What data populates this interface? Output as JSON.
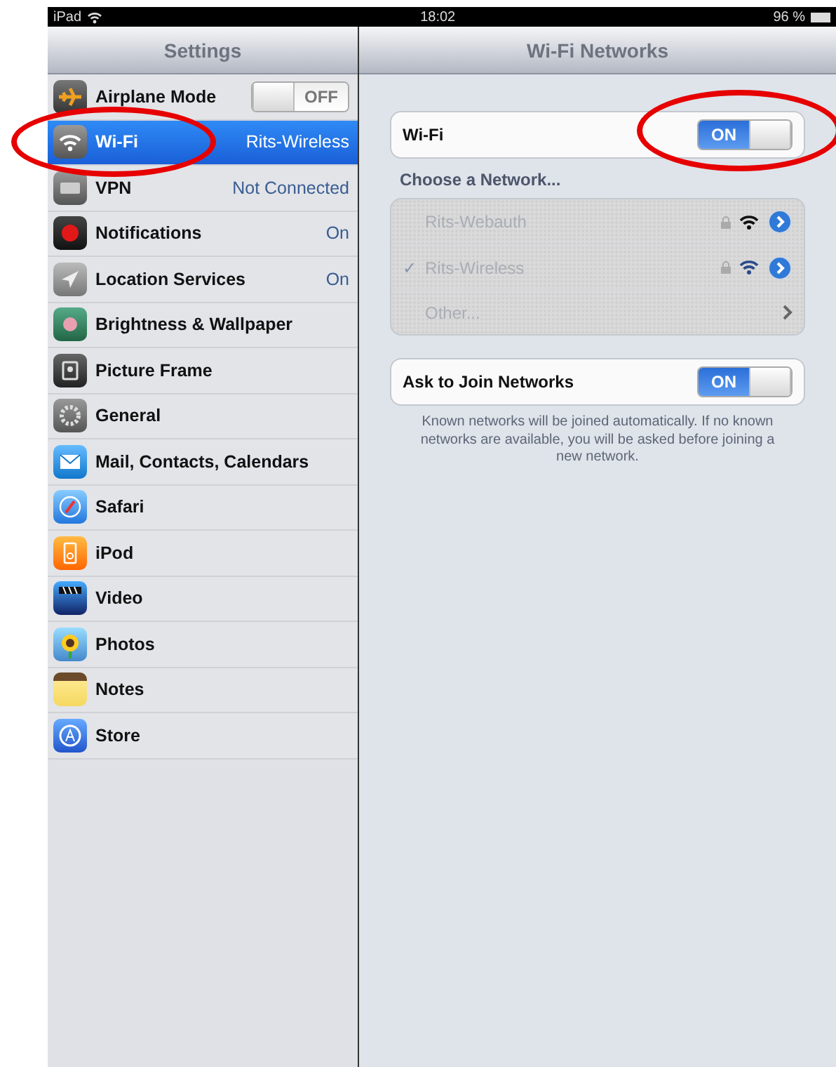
{
  "status_bar": {
    "device": "iPad",
    "time": "18:02",
    "battery": "96 %"
  },
  "sidebar": {
    "title": "Settings",
    "items": [
      {
        "label": "Airplane Mode",
        "kind": "toggle",
        "on": false,
        "toggle_label": "OFF",
        "selected": false
      },
      {
        "label": "Wi-Fi",
        "kind": "value",
        "value": "Rits-Wireless",
        "selected": true
      },
      {
        "label": "VPN",
        "kind": "value",
        "value": "Not Connected",
        "selected": false
      },
      {
        "label": "Notifications",
        "kind": "value",
        "value": "On",
        "selected": false
      },
      {
        "label": "Location Services",
        "kind": "value",
        "value": "On",
        "selected": false
      },
      {
        "label": "Brightness & Wallpaper",
        "kind": "plain",
        "selected": false
      },
      {
        "label": "Picture Frame",
        "kind": "plain",
        "selected": false
      },
      {
        "label": "General",
        "kind": "plain",
        "selected": false
      },
      {
        "label": "Mail, Contacts, Calendars",
        "kind": "plain",
        "selected": false
      },
      {
        "label": "Safari",
        "kind": "plain",
        "selected": false
      },
      {
        "label": "iPod",
        "kind": "plain",
        "selected": false
      },
      {
        "label": "Video",
        "kind": "plain",
        "selected": false
      },
      {
        "label": "Photos",
        "kind": "plain",
        "selected": false
      },
      {
        "label": "Notes",
        "kind": "plain",
        "selected": false
      },
      {
        "label": "Store",
        "kind": "plain",
        "selected": false
      }
    ]
  },
  "detail": {
    "title": "Wi-Fi Networks",
    "wifi": {
      "label": "Wi-Fi",
      "on": true,
      "toggle_label": "ON"
    },
    "section_title": "Choose a Network...",
    "networks": [
      {
        "name": "Rits-Webauth",
        "kind": "network",
        "checked": false
      },
      {
        "name": "Rits-Wireless",
        "kind": "network",
        "checked": true,
        "check": "✓"
      },
      {
        "name": "Other...",
        "kind": "other",
        "checked": false
      }
    ],
    "ask_to_join": {
      "label": "Ask to Join Networks",
      "on": true,
      "toggle_label": "ON"
    },
    "footnote": "Known networks will be joined automatically.  If no known networks are available, you will be asked before joining a new network."
  }
}
